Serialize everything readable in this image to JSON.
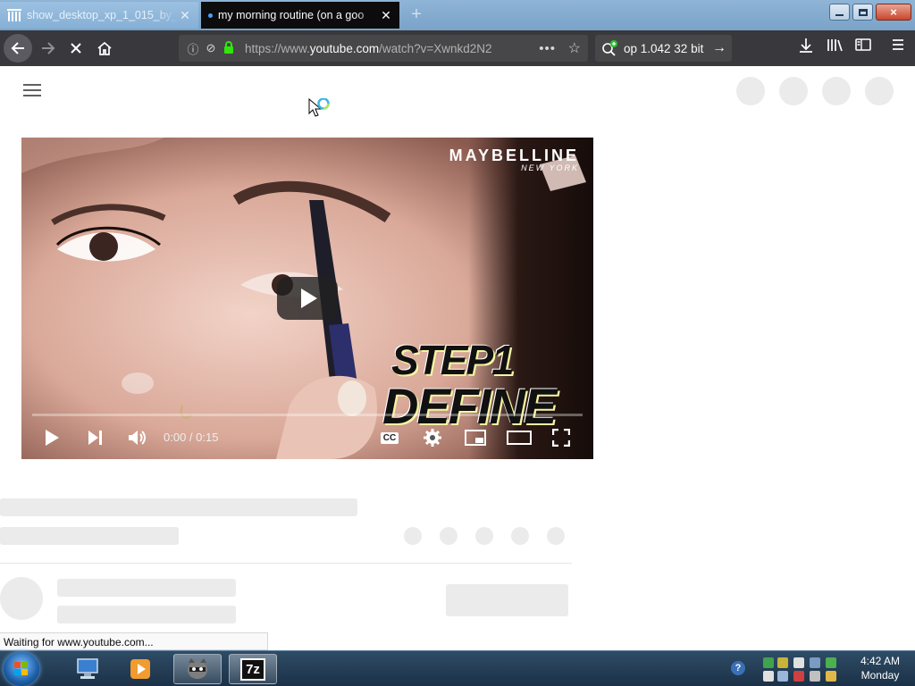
{
  "browser": {
    "tabs": [
      {
        "title": "show_desktop_xp_1_015_by_c",
        "active": false
      },
      {
        "title": "my morning routine (on a goo",
        "active": true
      }
    ],
    "window_close": "×",
    "url": {
      "prefix": "https://www.",
      "domain": "youtube.com",
      "rest": "/watch?v=Xwnkd2N2"
    },
    "url_more": "•••",
    "search_text": "op 1.042 32 bit"
  },
  "video": {
    "watermark_brand": "MAYBELLINE",
    "watermark_sub": "NEW YORK",
    "overlay_line1": "STEP1",
    "overlay_line2": "DEFINE",
    "time": "0:00 / 0:15",
    "progress": 0.0,
    "cc_label": "CC"
  },
  "status": "Waiting for www.youtube.com...",
  "taskbar": {
    "clock_time": "4:42 AM",
    "clock_day": "Monday",
    "help": "?",
    "app_7z": "7z"
  },
  "colors": {
    "accent": "#ff0000",
    "toolbar": "#38383d",
    "skeleton": "#ebebeb"
  }
}
